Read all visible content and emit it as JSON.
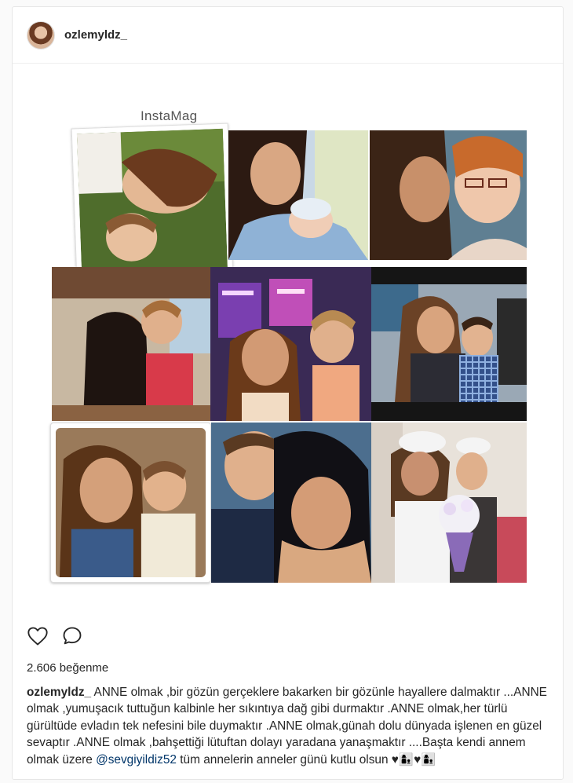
{
  "post": {
    "username": "ozlemyldz_",
    "likes_text": "2.606 beğenme"
  },
  "collage": {
    "brand": "InstaMag",
    "photos": [
      {
        "id": "mother-son-on-grass",
        "scene": "lying on grass"
      },
      {
        "id": "mother-with-newborn",
        "scene": "hospital bed with newborn"
      },
      {
        "id": "kiss-elderly-mother",
        "scene": "kiss on cheek"
      },
      {
        "id": "restaurant-hug",
        "scene": "terrace hug"
      },
      {
        "id": "tv-studio",
        "scene": "studio lights"
      },
      {
        "id": "arms-around-son",
        "scene": "indoor hug"
      },
      {
        "id": "vintage-selfie",
        "scene": "sepia portrait"
      },
      {
        "id": "dark-hair-selfie",
        "scene": "close selfie"
      },
      {
        "id": "flower-bouquet",
        "scene": "white caps and bouquet"
      }
    ]
  },
  "caption": {
    "username": "ozlemyldz_",
    "text_before_mention": " ANNE olmak ,bir gözün gerçeklere bakarken bir gözünle hayallere dalmaktır ...ANNE olmak ,yumuşacık tuttuğun kalbinle her sıkıntıya dağ gibi durmaktır .ANNE olmak,her türlü gürültüde evladın tek nefesini bile duymaktır .ANNE olmak,günah dolu dünyada işlenen en güzel sevaptır .ANNE olmak ,bahşettiği lütuftan dolayı yaradana yanaşmaktır ....Başta kendi annem olmak üzere ",
    "mention": "@sevgiyildiz52",
    "text_after_mention": " tüm annelerin anneler günü kutlu olsun ♥👩‍👦♥👩‍👦"
  },
  "icons": {
    "like": "heart-outline-icon",
    "comment": "speech-bubble-icon"
  },
  "colors": {
    "text": "#262626",
    "mention": "#003569",
    "border": "#e6e6e6"
  }
}
